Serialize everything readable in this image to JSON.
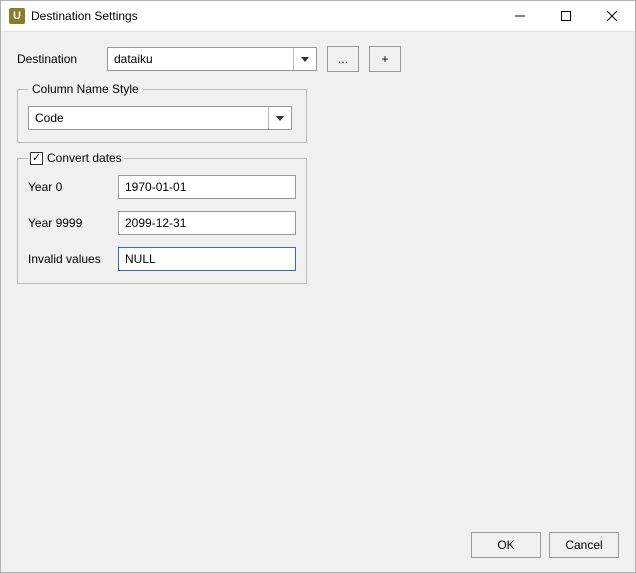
{
  "window": {
    "title": "Destination Settings",
    "icon_letter": "U"
  },
  "destination": {
    "label": "Destination",
    "value": "dataiku",
    "browse_label": "...",
    "add_label": "+"
  },
  "column_style": {
    "legend": "Column Name Style",
    "value": "Code"
  },
  "convert": {
    "legend": "Convert dates",
    "checked": true,
    "year0_label": "Year 0",
    "year0_value": "1970-01-01",
    "year9999_label": "Year 9999",
    "year9999_value": "2099-12-31",
    "invalid_label": "Invalid values",
    "invalid_value": "NULL"
  },
  "buttons": {
    "ok": "OK",
    "cancel": "Cancel"
  }
}
